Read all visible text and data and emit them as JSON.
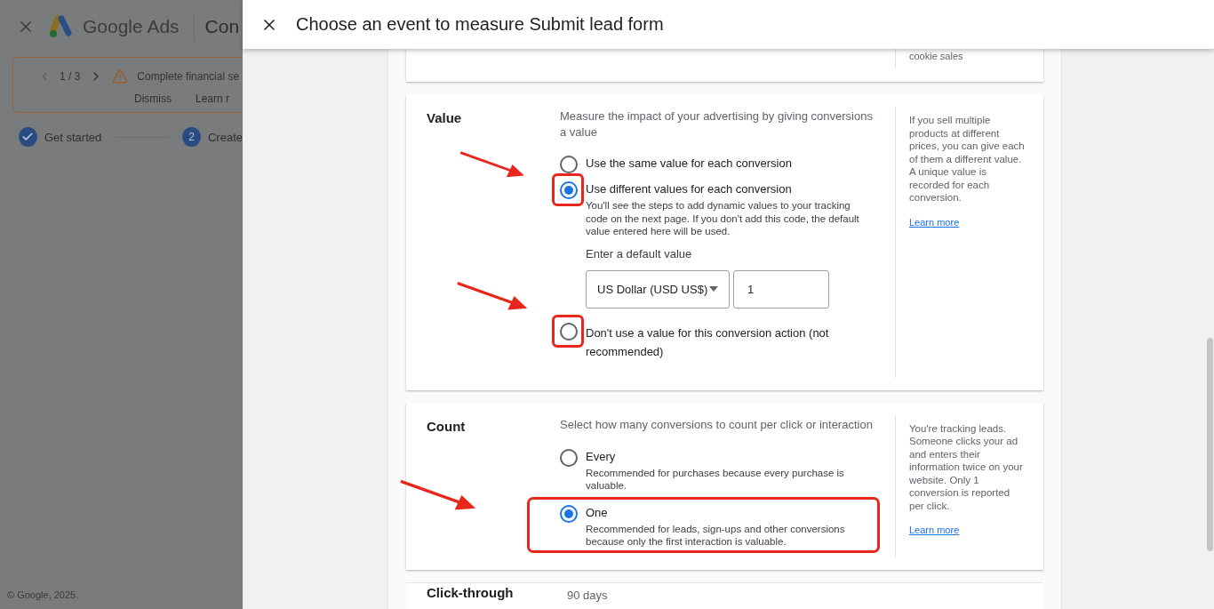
{
  "page": {
    "brand": "Google Ads",
    "section_title": "Con",
    "banner": {
      "pager": "1 / 3",
      "message": "Complete financial se",
      "actions": [
        "Dismiss",
        "Learn r"
      ]
    },
    "steps": [
      {
        "label": "Get started",
        "done": true
      },
      {
        "label": "Create",
        "number": "2",
        "done": false
      }
    ],
    "footer": "© Google, 2025."
  },
  "dialog": {
    "title": "Choose an event to measure Submit lead form",
    "top_side_text": "cookie sales",
    "sections": [
      {
        "label": "Value",
        "description": "Measure the impact of your advertising by giving conversions a value",
        "options": [
          {
            "label": "Use the same value for each conversion",
            "selected": false
          },
          {
            "label": "Use different values for each conversion",
            "hint": "You'll see the steps to add dynamic values to your tracking code on the next page. If you don't add this code, the default value entered here will be used.",
            "selected": true,
            "radio_highlighted": true,
            "default_value": {
              "label": "Enter a default value",
              "currency": "US Dollar (USD US$)",
              "amount": "1"
            }
          },
          {
            "label": "Don't use a value for this conversion action (not recommended)",
            "selected": false,
            "radio_highlighted": true
          }
        ],
        "side_text": "If you sell multiple products at different prices, you can give each of them a different value. A unique value is recorded for each conversion.",
        "side_link": "Learn more"
      },
      {
        "label": "Count",
        "description": "Select how many conversions to count per click or interaction",
        "options": [
          {
            "label": "Every",
            "hint": "Recommended for purchases because every purchase is valuable.",
            "selected": false
          },
          {
            "label": "One",
            "hint": "Recommended for leads, sign-ups and other conversions because only the first interaction is valuable.",
            "selected": true,
            "option_highlighted": true
          }
        ],
        "side_text": "You're tracking leads. Someone clicks your ad and enters their information twice on your website. Only 1 conversion is reported per click.",
        "side_link": "Learn more"
      }
    ],
    "next_section": {
      "label": "Click-through",
      "value": "90 days"
    }
  }
}
